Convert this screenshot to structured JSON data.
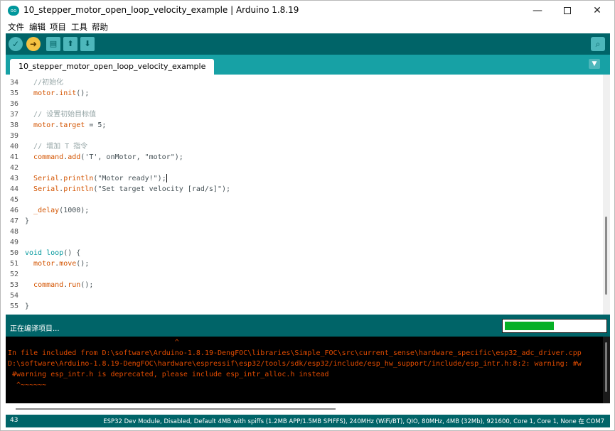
{
  "window": {
    "title": "10_stepper_motor_open_loop_velocity_example | Arduino 1.8.19",
    "logo": "oo",
    "minimize": "—",
    "close": "✕"
  },
  "menu": [
    "文件",
    "编辑",
    "项目",
    "工具",
    "帮助"
  ],
  "toolbar": {
    "verify_icon": "✓",
    "upload_icon": "➜",
    "new_icon": "▤",
    "open_icon": "⬆",
    "save_icon": "⬇",
    "monitor_icon": "⌕"
  },
  "tab": {
    "label": "10_stepper_motor_open_loop_velocity_example",
    "menu_icon": "▼"
  },
  "editor": {
    "lines": [
      {
        "n": "34",
        "segs": [
          {
            "t": "  ",
            "c": ""
          },
          {
            "t": "//初始化",
            "c": "c-comment"
          }
        ]
      },
      {
        "n": "35",
        "segs": [
          {
            "t": "  ",
            "c": ""
          },
          {
            "t": "motor",
            "c": "c-obj"
          },
          {
            "t": ".",
            "c": ""
          },
          {
            "t": "init",
            "c": "c-obj"
          },
          {
            "t": "();",
            "c": ""
          }
        ]
      },
      {
        "n": "36",
        "segs": []
      },
      {
        "n": "37",
        "segs": [
          {
            "t": "  ",
            "c": ""
          },
          {
            "t": "// 设置初始目标值",
            "c": "c-comment"
          }
        ]
      },
      {
        "n": "38",
        "segs": [
          {
            "t": "  ",
            "c": ""
          },
          {
            "t": "motor",
            "c": "c-obj"
          },
          {
            "t": ".",
            "c": ""
          },
          {
            "t": "target",
            "c": "c-obj"
          },
          {
            "t": " = 5;",
            "c": ""
          }
        ]
      },
      {
        "n": "39",
        "segs": []
      },
      {
        "n": "40",
        "segs": [
          {
            "t": "  ",
            "c": ""
          },
          {
            "t": "// 增加 T 指令",
            "c": "c-comment"
          }
        ]
      },
      {
        "n": "41",
        "segs": [
          {
            "t": "  ",
            "c": ""
          },
          {
            "t": "command",
            "c": "c-obj"
          },
          {
            "t": ".",
            "c": ""
          },
          {
            "t": "add",
            "c": "c-obj"
          },
          {
            "t": "('T', onMotor, \"motor\");",
            "c": ""
          }
        ]
      },
      {
        "n": "42",
        "segs": []
      },
      {
        "n": "43",
        "segs": [
          {
            "t": "  ",
            "c": ""
          },
          {
            "t": "Serial",
            "c": "c-obj"
          },
          {
            "t": ".",
            "c": ""
          },
          {
            "t": "println",
            "c": "c-obj"
          },
          {
            "t": "(\"Motor ready!\");",
            "c": ""
          }
        ],
        "caret": true
      },
      {
        "n": "44",
        "segs": [
          {
            "t": "  ",
            "c": ""
          },
          {
            "t": "Serial",
            "c": "c-obj"
          },
          {
            "t": ".",
            "c": ""
          },
          {
            "t": "println",
            "c": "c-obj"
          },
          {
            "t": "(\"Set target velocity [rad/s]\");",
            "c": ""
          }
        ]
      },
      {
        "n": "45",
        "segs": []
      },
      {
        "n": "46",
        "segs": [
          {
            "t": "  ",
            "c": ""
          },
          {
            "t": "_delay",
            "c": "c-obj"
          },
          {
            "t": "(1000);",
            "c": ""
          }
        ]
      },
      {
        "n": "47",
        "segs": [
          {
            "t": "}",
            "c": ""
          }
        ]
      },
      {
        "n": "48",
        "segs": []
      },
      {
        "n": "49",
        "segs": []
      },
      {
        "n": "50",
        "segs": [
          {
            "t": "void",
            "c": "c-kw"
          },
          {
            "t": " ",
            "c": ""
          },
          {
            "t": "loop",
            "c": "c-kw"
          },
          {
            "t": "() {",
            "c": ""
          }
        ]
      },
      {
        "n": "51",
        "segs": [
          {
            "t": "  ",
            "c": ""
          },
          {
            "t": "motor",
            "c": "c-obj"
          },
          {
            "t": ".",
            "c": ""
          },
          {
            "t": "move",
            "c": "c-obj"
          },
          {
            "t": "();",
            "c": ""
          }
        ]
      },
      {
        "n": "52",
        "segs": []
      },
      {
        "n": "53",
        "segs": [
          {
            "t": "  ",
            "c": ""
          },
          {
            "t": "command",
            "c": "c-obj"
          },
          {
            "t": ".",
            "c": ""
          },
          {
            "t": "run",
            "c": "c-obj"
          },
          {
            "t": "();",
            "c": ""
          }
        ]
      },
      {
        "n": "54",
        "segs": []
      },
      {
        "n": "55",
        "segs": [
          {
            "t": "}",
            "c": ""
          }
        ]
      }
    ]
  },
  "status": {
    "text": "正在编译项目...",
    "progress": 0.49
  },
  "console": {
    "lines": [
      "                                       ^",
      "In file included from D:\\software\\Arduino-1.8.19-DengFOC\\libraries\\Simple_FOC\\src\\current_sense\\hardware_specific\\esp32_adc_driver.cpp",
      "D:\\software\\Arduino-1.8.19-DengFOC\\hardware\\espressif\\esp32/tools/sdk/esp32/include/esp_hw_support/include/esp_intr.h:8:2: warning: #w",
      " #warning esp_intr.h is deprecated, please include esp_intr_alloc.h instead",
      "  ^~~~~~~"
    ]
  },
  "bottom": {
    "line_number": "43",
    "board_info": "ESP32 Dev Module, Disabled, Default 4MB with spiffs (1.2MB APP/1.5MB SPIFFS), 240MHz (WiFi/BT), QIO, 80MHz, 4MB (32Mb), 921600, Core 1, Core 1, None 在 COM7"
  },
  "colors": {
    "teal_dark": "#006468",
    "teal_tab": "#17a1a5",
    "console_text": "#e34c00",
    "progress": "#06b025"
  }
}
